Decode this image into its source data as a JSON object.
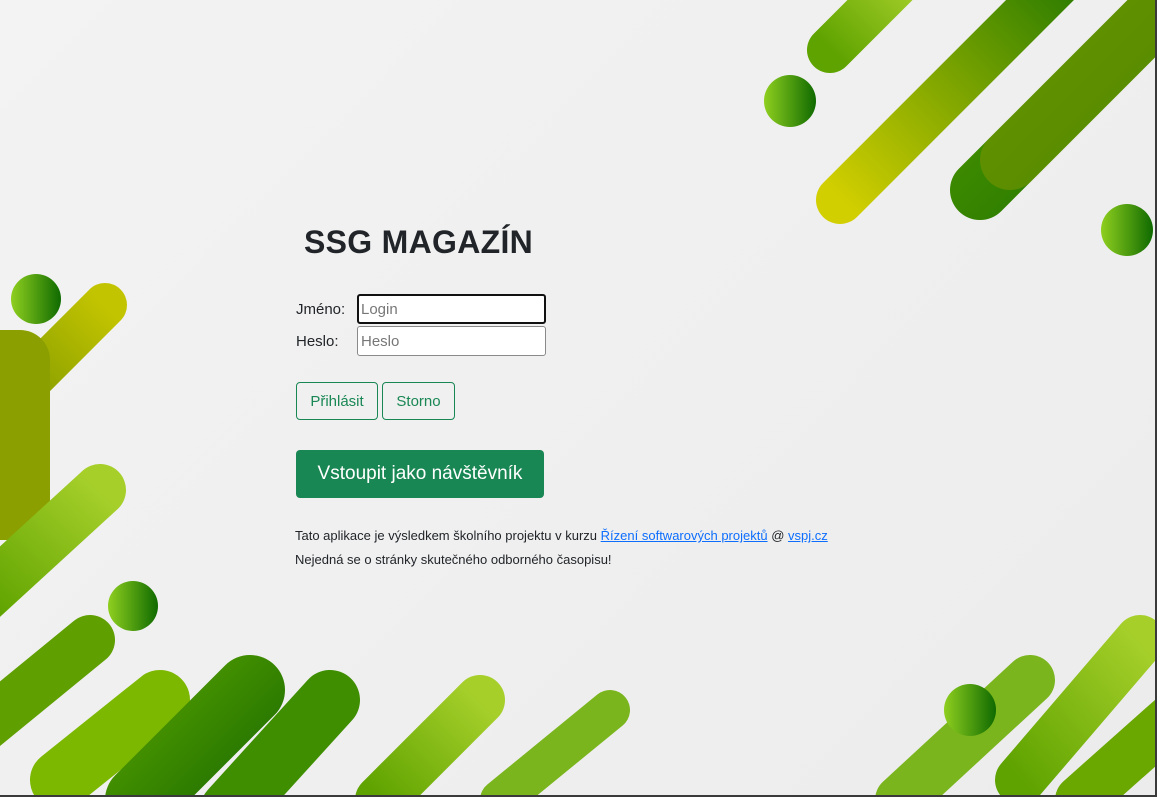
{
  "app": {
    "title": "SSG MAGAZÍN"
  },
  "login_form": {
    "username_label": "Jméno:",
    "username_placeholder": "Login",
    "username_value": "",
    "password_label": "Heslo:",
    "password_placeholder": "Heslo",
    "password_value": "",
    "login_button": "Přihlásit",
    "cancel_button": "Storno",
    "guest_button": "Vstoupit jako návštěvník"
  },
  "footer": {
    "line1_text": "Tato aplikace je výsledkem školního projektu v kurzu",
    "course_link": "Řízení softwarových projektů",
    "at_sign": "@",
    "school_link": "vspj.cz",
    "line2_text": "Nejedná se o stránky skutečného odborného časopisu!"
  },
  "colors": {
    "primary_green": "#198754",
    "link_blue": "#0d6efd",
    "shape_yellow": "#c8cc00",
    "shape_dark_green": "#1f7a00",
    "shape_light_green": "#8dc21f"
  }
}
